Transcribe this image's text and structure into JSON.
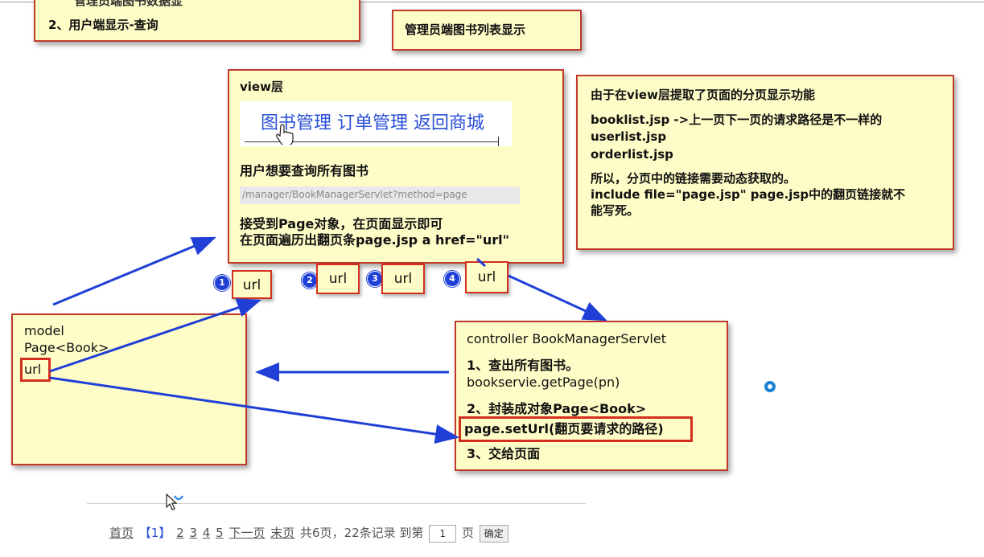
{
  "top_boxes": {
    "partial_line": "管理员端图书数据显",
    "user_query": "2、用户端显示-查询",
    "admin_title": "管理员端图书列表显示"
  },
  "view_box": {
    "title": "view层",
    "nav": "图书管理 订单管理 返回商城",
    "query_text": "用户想要查询所有图书",
    "url": "/manager/BookManagerServlet?method=page",
    "line1": "接受到Page对象，在页面显示即可",
    "line2": "在页面遍历出翻页条page.jsp  a href=\"url\""
  },
  "note_box": {
    "line1": "由于在view层提取了页面的分页显示功能",
    "line2": "booklist.jsp  ->上一页下一页的请求路径是不一样的",
    "line3": "userlist.jsp",
    "line4": "orderlist.jsp",
    "line5": "所以，分页中的链接需要动态获取的。",
    "line6": "include  file=\"page.jsp\"  page.jsp中的翻页链接就不",
    "line7": "能写死。"
  },
  "url_boxes": [
    {
      "num": "1",
      "label": "url"
    },
    {
      "num": "2",
      "label": "url"
    },
    {
      "num": "3",
      "label": "url"
    },
    {
      "num": "4",
      "label": "url"
    }
  ],
  "model_box": {
    "line1": "model",
    "line2": "Page<Book>",
    "line3": "url"
  },
  "controller_box": {
    "title": "controller  BookManagerServlet",
    "step1": "1、查出所有图书。",
    "step1_code": "bookservie.getPage(pn)",
    "step2": "2、封装成对象Page<Book>",
    "step2_code": "page.setUrl(翻页要请求的路径)",
    "step3": "3、交给页面"
  },
  "pagination": {
    "first": "首页",
    "current": "【1】",
    "p2": "2",
    "p3": "3",
    "p4": "4",
    "p5": "5",
    "next": "下一页",
    "last": "末页",
    "summary": "共6页，22条记录 到第",
    "page_value": "1",
    "page_suffix": "页",
    "confirm": "确定"
  },
  "colors": {
    "box_fill": "#fffdc7",
    "box_border": "#c0392b",
    "arrow": "#1f3fd6",
    "nav_link": "#2a4fd6"
  }
}
